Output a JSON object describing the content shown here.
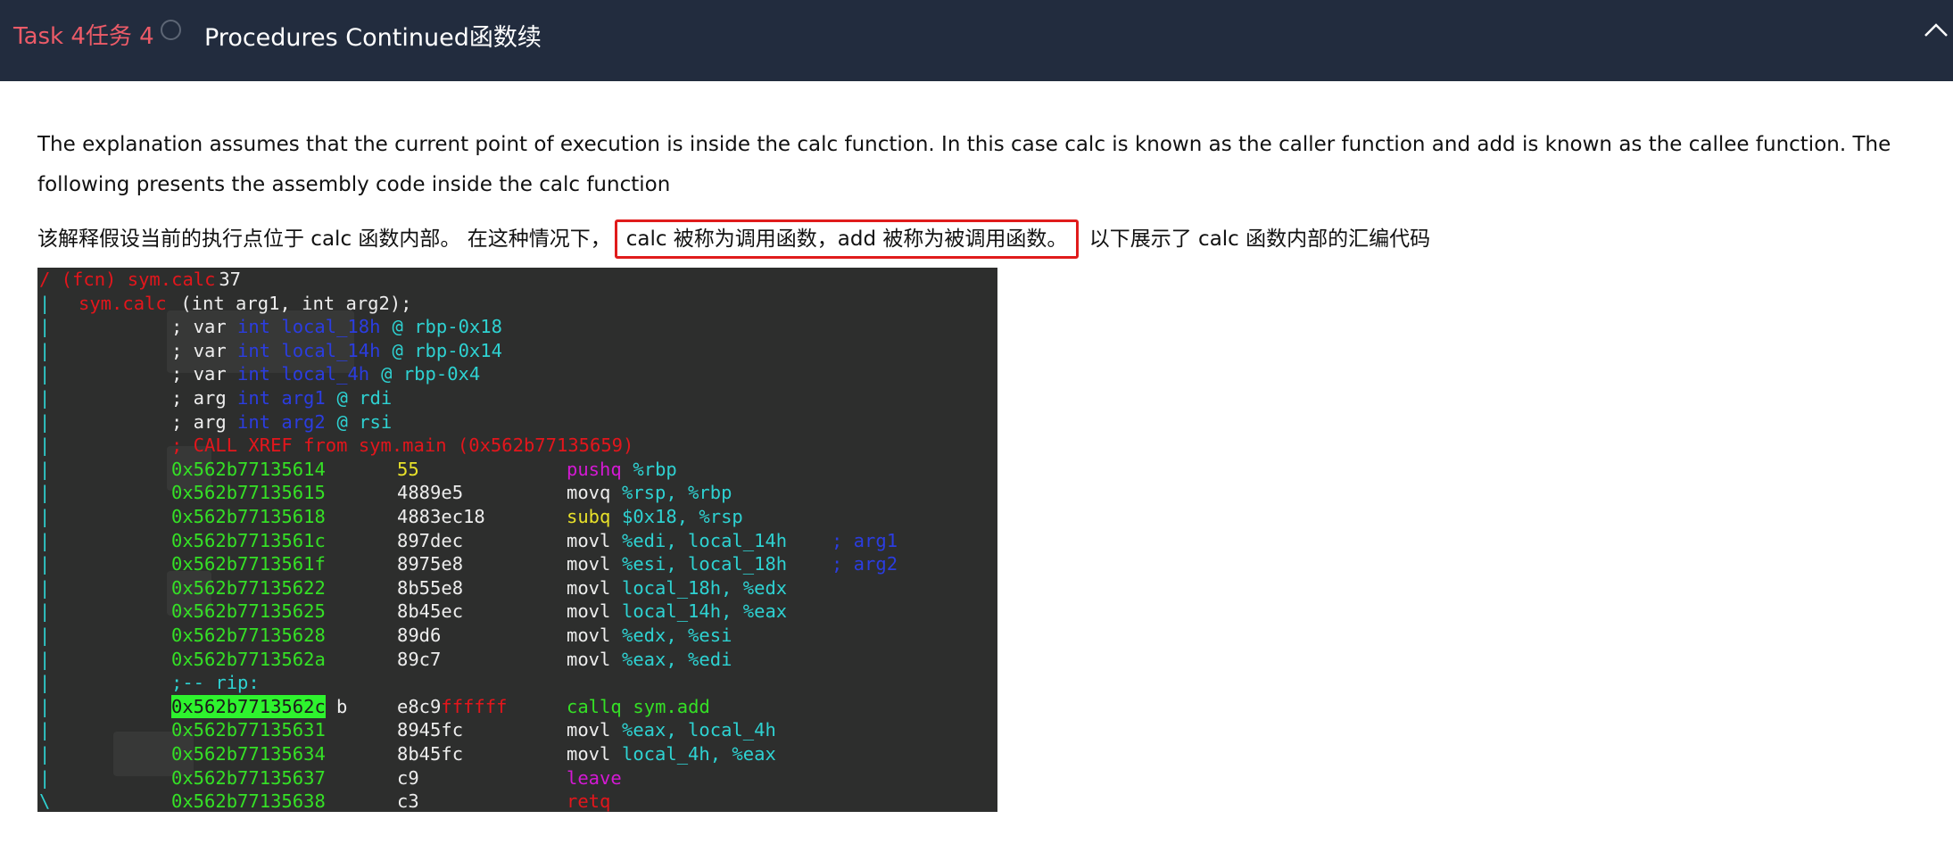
{
  "header": {
    "task_label": "Task 4任务 4",
    "title": "Procedures Continued函数续"
  },
  "content": {
    "paragraph_en": "The explanation assumes that the current point of execution is inside the calc function. In this case calc is known as the caller function and add is known as the callee function. The following presents the assembly code inside the calc function",
    "paragraph_cn_before": "该解释假设当前的执行点位于 calc 函数内部。 在这种情况下，",
    "paragraph_cn_highlight": "calc 被称为调用函数，add 被称为被调用函数。",
    "paragraph_cn_after": " 以下展示了 calc 函数内部的汇编代码"
  },
  "code": {
    "header": [
      "/ (fcn) sym.calc",
      " 37"
    ],
    "signature": [
      "sym.calc",
      " (int arg1, int arg2);"
    ],
    "vars": [
      [
        "; var ",
        "int local_18h",
        " @ rbp-0x18"
      ],
      [
        "; var ",
        "int local_14h",
        " @ rbp-0x14"
      ],
      [
        "; var ",
        "int local_4h",
        " @ rbp-0x4"
      ],
      [
        "; arg ",
        "int arg1",
        " @ rdi"
      ],
      [
        "; arg ",
        "int arg2",
        " @ rsi"
      ]
    ],
    "xref": "; CALL XREF from sym.main (0x562b77135659)",
    "rip_label": ";-- rip:",
    "instructions": [
      {
        "addr": "0x562b77135614",
        "bytes": "55",
        "mn": "pushq",
        "ops": "%rbp",
        "cmt": ""
      },
      {
        "addr": "0x562b77135615",
        "bytes": "4889e5",
        "mn": "movq",
        "ops": "%rsp, %rbp",
        "cmt": ""
      },
      {
        "addr": "0x562b77135618",
        "bytes": "4883ec18",
        "mn": "subq",
        "ops": "$0x18, %rsp",
        "cmt": ""
      },
      {
        "addr": "0x562b7713561c",
        "bytes": "897dec",
        "mn": "movl",
        "ops": "%edi, local_14h",
        "cmt": "; arg1"
      },
      {
        "addr": "0x562b7713561f",
        "bytes": "8975e8",
        "mn": "movl",
        "ops": "%esi, local_18h",
        "cmt": "; arg2"
      },
      {
        "addr": "0x562b77135622",
        "bytes": "8b55e8",
        "mn": "movl",
        "ops": "local_18h, %edx",
        "cmt": ""
      },
      {
        "addr": "0x562b77135625",
        "bytes": "8b45ec",
        "mn": "movl",
        "ops": "local_14h, %eax",
        "cmt": ""
      },
      {
        "addr": "0x562b77135628",
        "bytes": "89d6",
        "mn": "movl",
        "ops": "%edx, %esi",
        "cmt": ""
      },
      {
        "addr": "0x562b7713562a",
        "bytes": "89c7",
        "mn": "movl",
        "ops": "%eax, %edi",
        "cmt": ""
      },
      {
        "addr": "0x562b7713562c",
        "bytes": "e8c9ffffff",
        "mn": "callq",
        "ops": "sym.add",
        "cmt": "",
        "marker": "b"
      },
      {
        "addr": "0x562b77135631",
        "bytes": "8945fc",
        "mn": "movl",
        "ops": "%eax, local_4h",
        "cmt": ""
      },
      {
        "addr": "0x562b77135634",
        "bytes": "8b45fc",
        "mn": "movl",
        "ops": "local_4h, %eax",
        "cmt": ""
      },
      {
        "addr": "0x562b77135637",
        "bytes": "c9",
        "mn": "leave",
        "ops": "",
        "cmt": ""
      },
      {
        "addr": "0x562b77135638",
        "bytes": "c3",
        "mn": "retq",
        "ops": "",
        "cmt": ""
      }
    ]
  },
  "colors": {
    "header_bg": "#222c3e",
    "task_label": "#ec5b68",
    "highlight_border": "#e01b1b",
    "code_bg": "#2d2e2d"
  }
}
